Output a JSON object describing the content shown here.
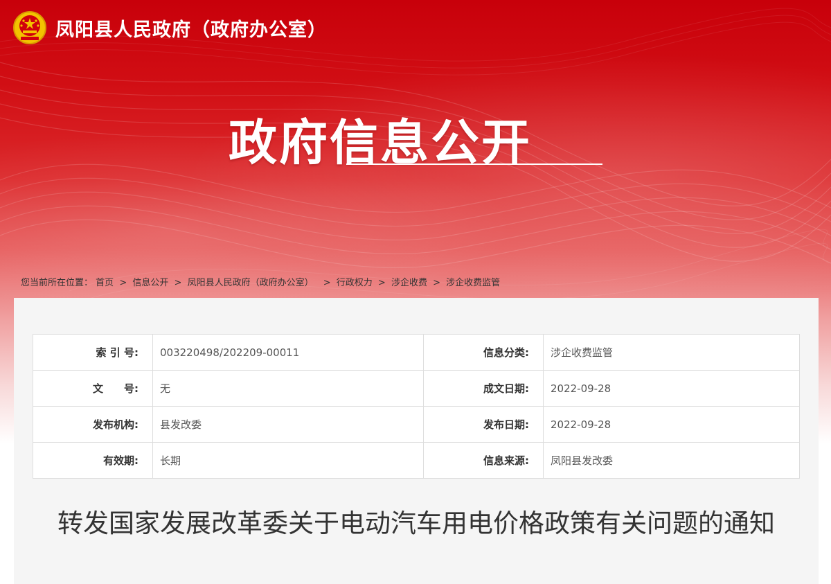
{
  "header": {
    "site_title": "凤阳县人民政府（政府办公室）",
    "emblem_icon": "national-emblem-icon"
  },
  "banner": {
    "section_title": "政府信息公开"
  },
  "breadcrumb": {
    "prefix": "您当前所在位置：",
    "items": [
      "首页",
      "信息公开",
      "凤阳县人民政府（政府办公室）",
      "行政权力",
      "涉企收费",
      "涉企收费监管"
    ],
    "separator": ">"
  },
  "meta": {
    "rows": [
      {
        "label_left": "索 引 号:",
        "value_left": "003220498/202209-00011",
        "label_right": "信息分类:",
        "value_right": "涉企收费监管"
      },
      {
        "label_left": "文　　号:",
        "value_left": "无",
        "label_right": "成文日期:",
        "value_right": "2022-09-28"
      },
      {
        "label_left": "发布机构:",
        "value_left": "县发改委",
        "label_right": "发布日期:",
        "value_right": "2022-09-28"
      },
      {
        "label_left": "有效期:",
        "value_left": "长期",
        "label_right": "信息来源:",
        "value_right": "凤阳县发改委"
      }
    ]
  },
  "document": {
    "title": "转发国家发展改革委关于电动汽车用电价格政策有关问题的通知"
  },
  "colors": {
    "brand_red": "#c8000a",
    "panel_bg": "#f5f5f5"
  }
}
